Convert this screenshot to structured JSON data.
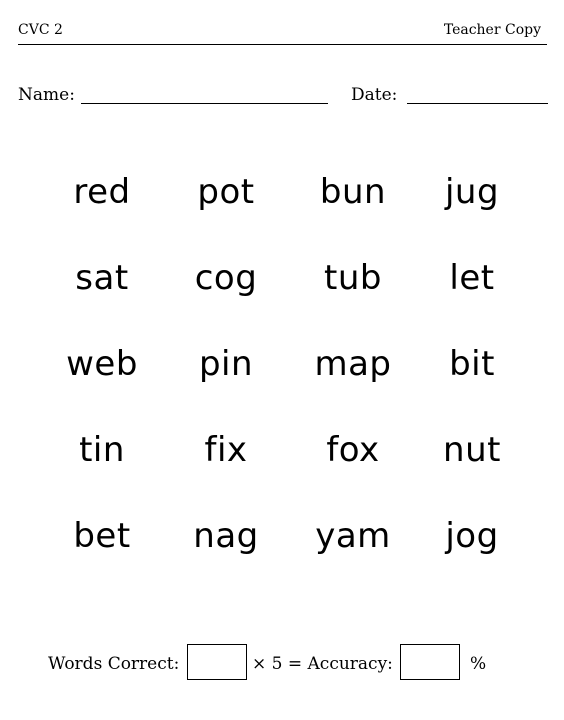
{
  "header": {
    "title": "CVC 2",
    "copy_label": "Teacher Copy"
  },
  "form": {
    "name_label": "Name:",
    "date_label": "Date:"
  },
  "words": {
    "rows": [
      [
        "red",
        "pot",
        "bun",
        "jug"
      ],
      [
        "sat",
        "cog",
        "tub",
        "let"
      ],
      [
        "web",
        "pin",
        "map",
        "bit"
      ],
      [
        "tin",
        "fix",
        "fox",
        "nut"
      ],
      [
        "bet",
        "nag",
        "yam",
        "jog"
      ]
    ]
  },
  "footer": {
    "words_correct_label": "Words Correct:",
    "multiplier_text": "× 5 = Accuracy:",
    "percent_symbol": "%"
  }
}
